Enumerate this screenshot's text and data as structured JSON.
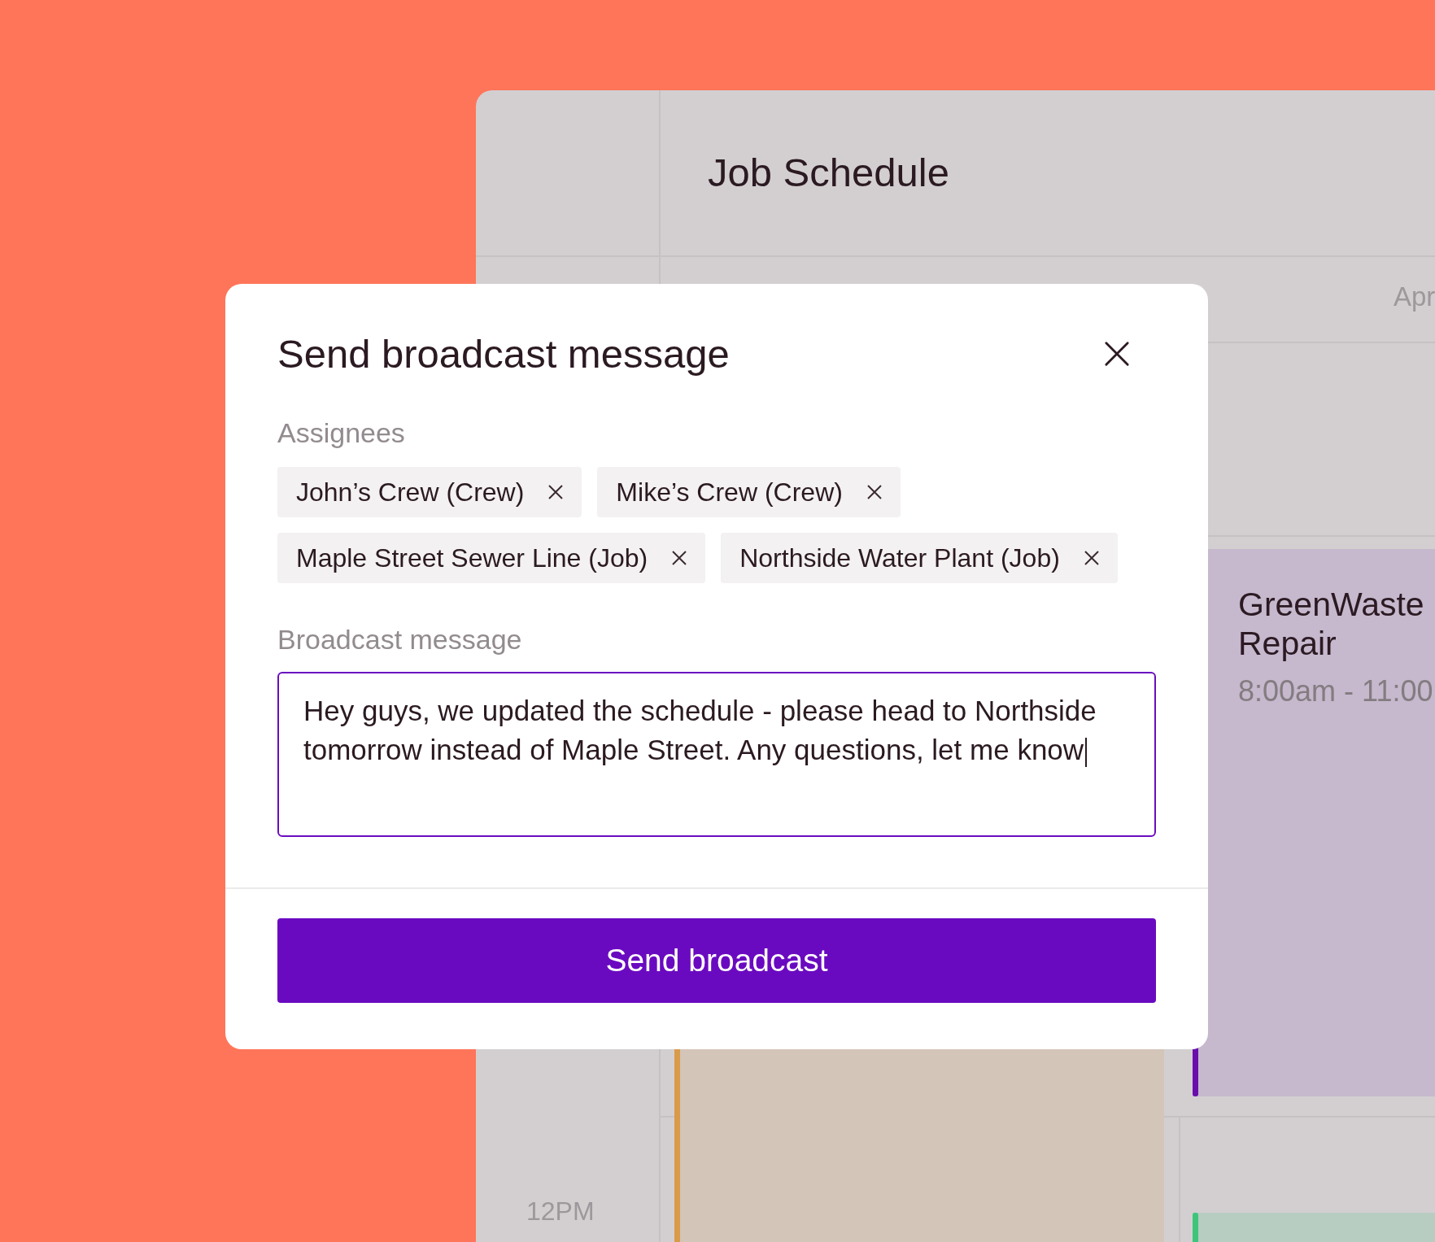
{
  "schedule": {
    "title": "Job Schedule",
    "date_header": "Apr",
    "time_label": "12PM",
    "events": [
      {
        "kind": "titled",
        "title_lines": [
          "GreenWaste",
          "Repair"
        ],
        "time": "8:00am - 11:00",
        "color": "#6a0dad"
      },
      {
        "kind": "plain",
        "color": "#d99a4a"
      },
      {
        "kind": "plain",
        "color": "#3fc57a"
      }
    ]
  },
  "dialog": {
    "title": "Send broadcast message",
    "assignees_label": "Assignees",
    "assignees": [
      {
        "label": "John’s Crew (Crew)"
      },
      {
        "label": "Mike’s Crew (Crew)"
      },
      {
        "label": "Maple Street Sewer Line (Job)"
      },
      {
        "label": "Northside Water Plant (Job)"
      }
    ],
    "message_label": "Broadcast message",
    "message": "Hey guys, we updated the schedule - please head to Northside tomorrow instead of Maple Street. Any questions, let me know",
    "send_button": "Send broadcast"
  }
}
